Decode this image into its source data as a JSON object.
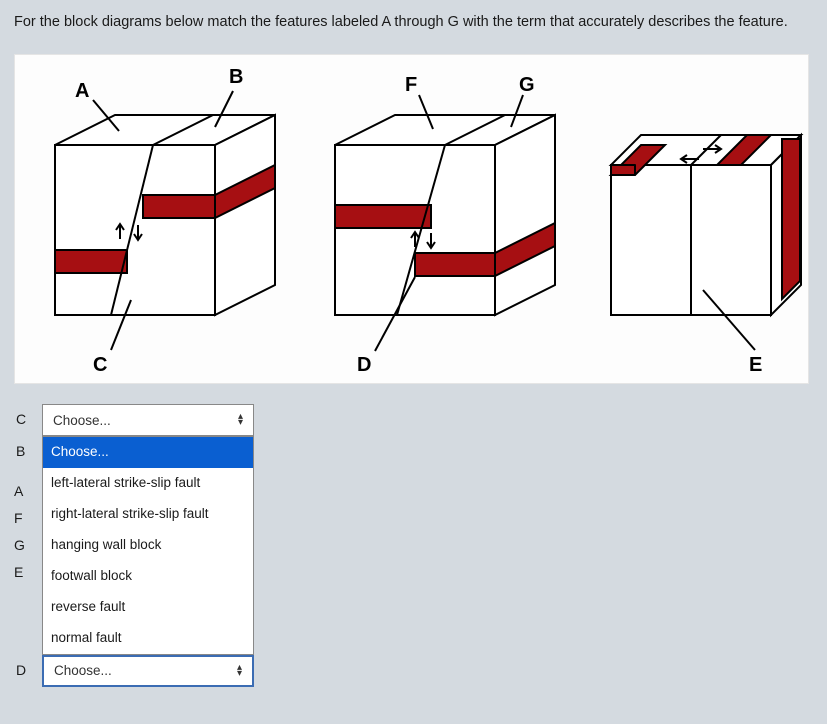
{
  "instruction": "For the block diagrams below match the features labeled A through G with the term that accurately describes the feature.",
  "diagram_labels": {
    "A": "A",
    "B": "B",
    "C": "C",
    "D": "D",
    "E": "E",
    "F": "F",
    "G": "G"
  },
  "dropdown": {
    "placeholder": "Choose...",
    "options": [
      "Choose...",
      "left-lateral strike-slip fault",
      "right-lateral strike-slip fault",
      "hanging wall block",
      "footwall block",
      "reverse fault",
      "normal fault"
    ]
  },
  "answer_rows": [
    {
      "label": "C",
      "value": "Choose...",
      "open": false
    },
    {
      "label": "B",
      "value": "Choose...",
      "open": true
    },
    {
      "label": "A",
      "value": "",
      "open": false,
      "hidden_control": true
    },
    {
      "label": "F",
      "value": "",
      "open": false,
      "hidden_control": true
    },
    {
      "label": "G",
      "value": "",
      "open": false,
      "hidden_control": true
    },
    {
      "label": "E",
      "value": "",
      "open": false,
      "hidden_control": true
    },
    {
      "label": "D",
      "value": "Choose...",
      "open": false
    }
  ]
}
